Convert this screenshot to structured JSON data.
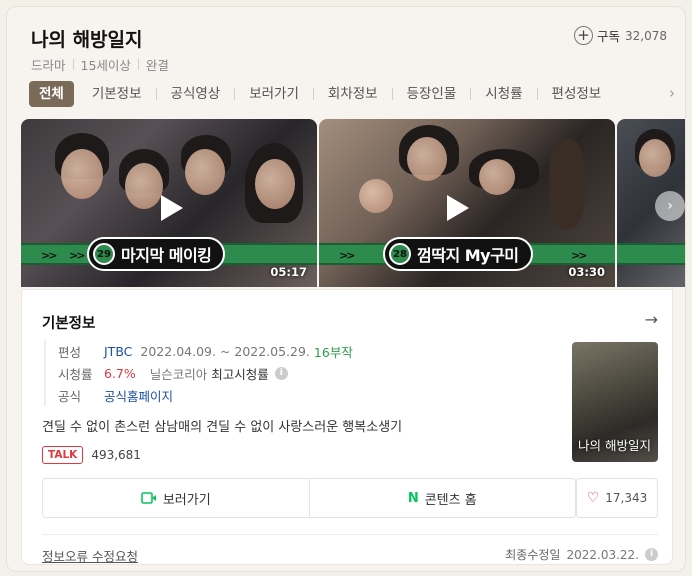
{
  "header": {
    "title": "나의 해방일지",
    "meta": [
      "드라마",
      "15세이상",
      "완결"
    ],
    "subscribe_label": "구독",
    "subscribe_count": "32,078"
  },
  "tabs": [
    "전체",
    "기본정보",
    "공식영상",
    "보러가기",
    "회차정보",
    "등장인물",
    "시청률",
    "편성정보"
  ],
  "videos": [
    {
      "episode": "29",
      "label": "마지막 메이킹",
      "duration": "05:17"
    },
    {
      "episode": "28",
      "label": "껌딱지 My구미",
      "duration": "03:30"
    }
  ],
  "info": {
    "section_title": "기본정보",
    "schedule_key": "편성",
    "channel": "JTBC",
    "period": "2022.04.09. ~ 2022.05.29.",
    "episodes": "16부작",
    "rating_key": "시청률",
    "rating": "6.7%",
    "rating_source": "닐슨코리아",
    "rating_desc": "최고시청률",
    "official_key": "공식",
    "official_link": "공식홈페이지",
    "description": "견딜 수 없이 촌스런 삼남매의 견딜 수 없이 사랑스러운 행복소생기",
    "talk_badge": "TALK",
    "talk_count": "493,681",
    "poster_title": "나의 해방일지"
  },
  "actions": {
    "watch_label": "보러가기",
    "contents_logo": "N",
    "contents_label": "콘텐츠 홈",
    "like_count": "17,343"
  },
  "footer": {
    "report_label": "정보오류 수정요청",
    "updated_label": "최종수정일",
    "updated_date": "2022.03.22."
  },
  "colors": {
    "accent": "#7a6a58",
    "green": "#2e8b4e",
    "naver": "#03c75a",
    "red": "#e0383e"
  }
}
